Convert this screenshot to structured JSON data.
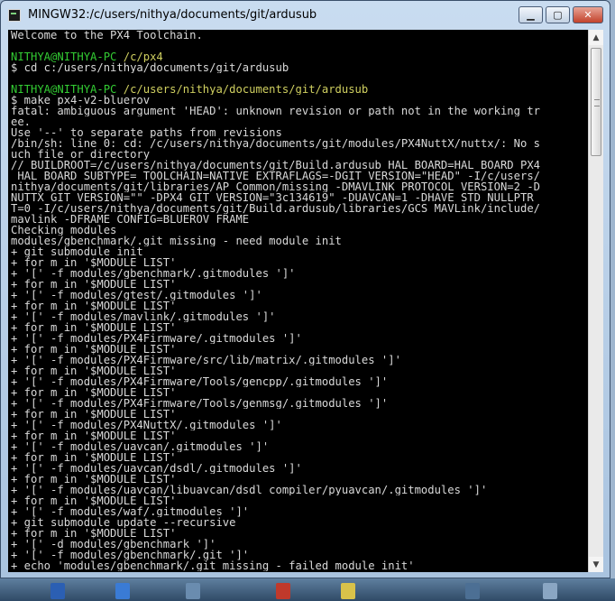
{
  "window": {
    "title": "MINGW32:/c/users/nithya/documents/git/ardusub"
  },
  "controls": {
    "minimize": "▁",
    "maximize": "▢",
    "close": "✕"
  },
  "terminal": {
    "lines": [
      {
        "type": "text",
        "text": "Welcome to the PX4 Toolchain."
      },
      {
        "type": "text",
        "text": ""
      },
      {
        "type": "prompt",
        "user": "NITHYA@NITHYA-PC",
        "path": "/c/px4"
      },
      {
        "type": "text",
        "text": "$ cd c:/users/nithya/documents/git/ardusub"
      },
      {
        "type": "text",
        "text": ""
      },
      {
        "type": "prompt",
        "user": "NITHYA@NITHYA-PC",
        "path": "/c/users/nithya/documents/git/ardusub"
      },
      {
        "type": "text",
        "text": "$ make px4-v2-bluerov"
      },
      {
        "type": "text",
        "text": "fatal: ambiguous argument 'HEAD': unknown revision or path not in the working tr"
      },
      {
        "type": "text",
        "text": "ee."
      },
      {
        "type": "text",
        "text": "Use '--' to separate paths from revisions"
      },
      {
        "type": "text",
        "text": "/bin/sh: line 0: cd: /c/users/nithya/documents/git/modules/PX4NuttX/nuttx/: No s"
      },
      {
        "type": "text",
        "text": "uch file or directory"
      },
      {
        "type": "text",
        "text": "// BUILDROOT=/c/users/nithya/documents/git/Build.ardusub HAL_BOARD=HAL_BOARD_PX4"
      },
      {
        "type": "text",
        "text": " HAL_BOARD_SUBTYPE= TOOLCHAIN=NATIVE EXTRAFLAGS=-DGIT_VERSION=\"HEAD\" -I/c/users/"
      },
      {
        "type": "text",
        "text": "nithya/documents/git/libraries/AP_Common/missing -DMAVLINK_PROTOCOL_VERSION=2 -D"
      },
      {
        "type": "text",
        "text": "NUTTX_GIT_VERSION=\"\" -DPX4_GIT_VERSION=\"3c134619\" -DUAVCAN=1 -DHAVE_STD_NULLPTR_"
      },
      {
        "type": "text",
        "text": "T=0 -I/c/users/nithya/documents/git/Build.ardusub/libraries/GCS_MAVLink/include/"
      },
      {
        "type": "text",
        "text": "mavlink -DFRAME_CONFIG=BLUEROV_FRAME"
      },
      {
        "type": "text",
        "text": "Checking modules"
      },
      {
        "type": "text",
        "text": "modules/gbenchmark/.git missing - need module init"
      },
      {
        "type": "text",
        "text": "+ git submodule init"
      },
      {
        "type": "text",
        "text": "+ for m in '$MODULE_LIST'"
      },
      {
        "type": "text",
        "text": "+ '[' -f modules/gbenchmark/.gitmodules ']'"
      },
      {
        "type": "text",
        "text": "+ for m in '$MODULE_LIST'"
      },
      {
        "type": "text",
        "text": "+ '[' -f modules/gtest/.gitmodules ']'"
      },
      {
        "type": "text",
        "text": "+ for m in '$MODULE_LIST'"
      },
      {
        "type": "text",
        "text": "+ '[' -f modules/mavlink/.gitmodules ']'"
      },
      {
        "type": "text",
        "text": "+ for m in '$MODULE_LIST'"
      },
      {
        "type": "text",
        "text": "+ '[' -f modules/PX4Firmware/.gitmodules ']'"
      },
      {
        "type": "text",
        "text": "+ for m in '$MODULE_LIST'"
      },
      {
        "type": "text",
        "text": "+ '[' -f modules/PX4Firmware/src/lib/matrix/.gitmodules ']'"
      },
      {
        "type": "text",
        "text": "+ for m in '$MODULE_LIST'"
      },
      {
        "type": "text",
        "text": "+ '[' -f modules/PX4Firmware/Tools/gencpp/.gitmodules ']'"
      },
      {
        "type": "text",
        "text": "+ for m in '$MODULE_LIST'"
      },
      {
        "type": "text",
        "text": "+ '[' -f modules/PX4Firmware/Tools/genmsg/.gitmodules ']'"
      },
      {
        "type": "text",
        "text": "+ for m in '$MODULE_LIST'"
      },
      {
        "type": "text",
        "text": "+ '[' -f modules/PX4NuttX/.gitmodules ']'"
      },
      {
        "type": "text",
        "text": "+ for m in '$MODULE_LIST'"
      },
      {
        "type": "text",
        "text": "+ '[' -f modules/uavcan/.gitmodules ']'"
      },
      {
        "type": "text",
        "text": "+ for m in '$MODULE_LIST'"
      },
      {
        "type": "text",
        "text": "+ '[' -f modules/uavcan/dsdl/.gitmodules ']'"
      },
      {
        "type": "text",
        "text": "+ for m in '$MODULE_LIST'"
      },
      {
        "type": "text",
        "text": "+ '[' -f modules/uavcan/libuavcan/dsdl_compiler/pyuavcan/.gitmodules ']'"
      },
      {
        "type": "text",
        "text": "+ for m in '$MODULE_LIST'"
      },
      {
        "type": "text",
        "text": "+ '[' -f modules/waf/.gitmodules ']'"
      },
      {
        "type": "text",
        "text": "+ git submodule update --recursive"
      },
      {
        "type": "text",
        "text": "+ for m in '$MODULE_LIST'"
      },
      {
        "type": "text",
        "text": "+ '[' -d modules/gbenchmark ']'"
      },
      {
        "type": "text",
        "text": "+ '[' -f modules/gbenchmark/.git ']'"
      },
      {
        "type": "text",
        "text": "+ echo 'modules/gbenchmark/.git missing - failed module init'"
      }
    ]
  },
  "scrollbar": {
    "up": "▲",
    "down": "▼"
  }
}
